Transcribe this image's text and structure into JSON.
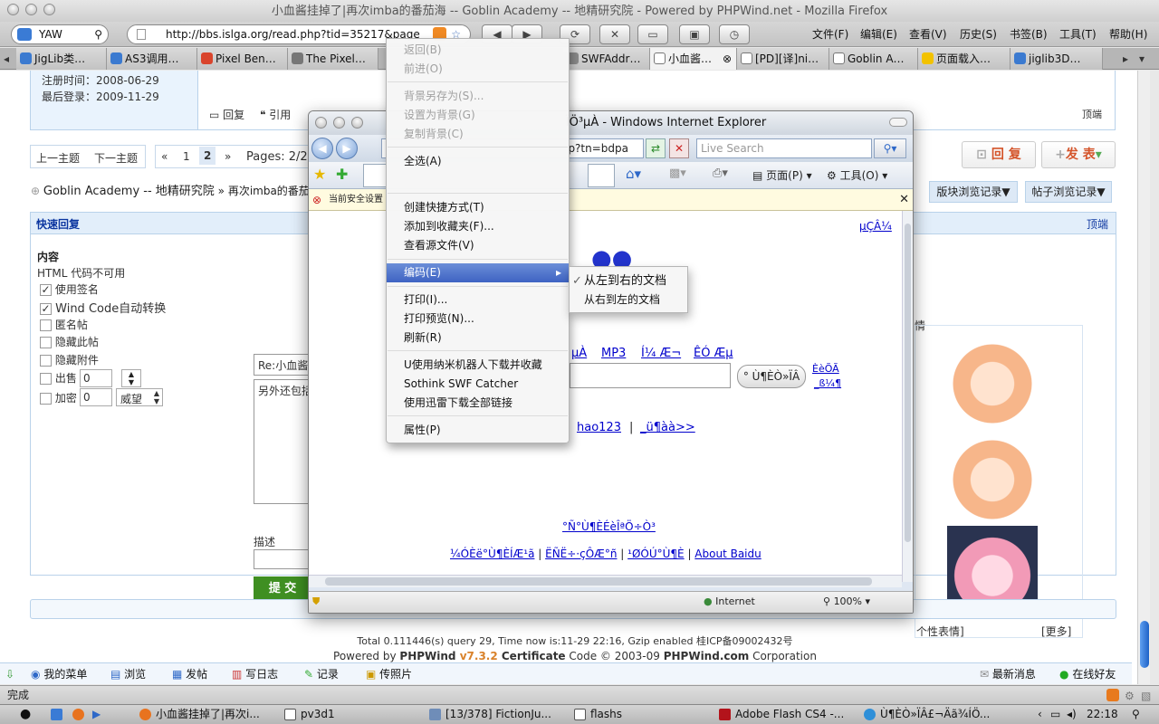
{
  "firefox": {
    "title": "小血酱挂掉了|再次imba的番茄海 -- Goblin Academy -- 地精研究院 - Powered by PHPWind.net - Mozilla Firefox",
    "search_value": "YAW",
    "url": "http://bbs.islga.org/read.php?tid=35217&page",
    "menus": [
      "文件(F)",
      "编辑(E)",
      "查看(V)",
      "历史(S)",
      "书签(B)",
      "工具(T)",
      "帮助(H)"
    ],
    "tabs": [
      "JigLib类…",
      "AS3调用…",
      "Pixel Ben…",
      "The Pixel…",
      "SWFAddr…",
      "小血酱…",
      "[PD][译]ni…",
      "Goblin A…",
      "页面载入…",
      "jiglib3D…"
    ],
    "status": "完成"
  },
  "forum": {
    "register_label": "注册时间：2008-06-29",
    "lastlogin_label": "最后登录：2009-11-29",
    "reply": "回复",
    "quote": "引用",
    "top": "顶端",
    "prev_topic": "上一主题",
    "next_topic": "下一主题",
    "pager": {
      "first": "«",
      "p1": "1",
      "p2": "2",
      "last": "»",
      "pages": "Pages: 2/2"
    },
    "btn_reply": "回 复",
    "btn_post": "发 表",
    "breadcrumb_home": "Goblin Academy -- 地精研究院",
    "breadcrumb_sep": "»",
    "breadcrumb_topic": "再次imba的番茄海",
    "board_history": "版块浏览记录▼",
    "post_history": "帖子浏览记录▼",
    "quick_reply": "快速回复",
    "top2": "顶端",
    "content_label": "内容",
    "html_note": "HTML 代码不可用",
    "opt_signature": "使用签名",
    "opt_windcode": "Wind Code自动转换",
    "opt_anonymous": "匿名帖",
    "opt_hide": "隐藏此帖",
    "opt_hide_attach": "隐藏附件",
    "opt_sell": "出售",
    "sell_value": "0",
    "opt_encrypt": "加密",
    "encrypt_value": "0",
    "prestige": "威望",
    "subject_value": "Re:小血酱",
    "body_value": "另外还包括",
    "desc_label": "描述",
    "submit": "提 交",
    "emoticon_head": "情",
    "emoticon_label": "个性表情]",
    "more": "[更多]",
    "footer1": "Total 0.111446(s) query 29, Time now is:11-29 22:16, Gzip enabled 桂ICP备09002432号",
    "footer2_pre": "Powered by ",
    "footer2_brand": "PHPWind",
    "footer2_ver": " v7.3.2 ",
    "footer2_cert": "Certificate",
    "footer2_mid": " Code © 2003-09 ",
    "footer2_site": "PHPWind.com",
    "footer2_end": " Corporation",
    "bar_items": [
      "我的菜单",
      "浏览",
      "发帖",
      "写日志",
      "记录",
      "传照片"
    ],
    "msg": "最新消息",
    "online": "在线好友"
  },
  "ie": {
    "title": "ÏÖ³µÀ - Windows Internet Explorer",
    "url_tail": "p?tn=bdpa",
    "search_placeholder": "Live Search",
    "page_menu": "页面(P)",
    "tools_menu": "工具(O)",
    "info_bar": "当前安全设置",
    "link_top": "µÇÂ¼",
    "nav_links": [
      "µÀ",
      "MP3",
      "Í¼ Æ¬",
      "ÊÓ Æµ"
    ],
    "search_btn": "° Ù¶ÈÒ»ÏÂ",
    "side_link1": "ÈèÕÃ",
    "side_link2": "_ß¼¶",
    "hao123": "hao123",
    "more_link": "_ü¶àà>>",
    "center_link": "°Ñ°Ù¶ÈÉèÎªÖ÷Ò³",
    "foot_links": [
      "¼ÓÈë°Ù¶ÈÍÆ¹ã",
      "ËÑË÷·çÔÆ°ñ",
      "¹ØÓÚ°Ù¶È",
      "About Baidu"
    ],
    "zone": "Internet",
    "zoom": "100%"
  },
  "context_menu": {
    "items": [
      {
        "label": "返回(B)",
        "enabled": false
      },
      {
        "label": "前进(O)",
        "enabled": false
      },
      {
        "label": "背景另存为(S)...",
        "enabled": false
      },
      {
        "label": "设置为背景(G)",
        "enabled": false
      },
      {
        "label": "复制背景(C)",
        "enabled": false
      },
      {
        "label": "全选(A)",
        "enabled": true
      },
      {
        "label": "创建快捷方式(T)",
        "enabled": true
      },
      {
        "label": "添加到收藏夹(F)...",
        "enabled": true
      },
      {
        "label": "查看源文件(V)",
        "enabled": true
      },
      {
        "label": "编码(E)",
        "enabled": true
      },
      {
        "label": "打印(I)...",
        "enabled": true
      },
      {
        "label": "打印预览(N)...",
        "enabled": true
      },
      {
        "label": "刷新(R)",
        "enabled": true
      },
      {
        "label": "U使用纳米机器人下载并收藏",
        "enabled": true
      },
      {
        "label": "Sothink SWF Catcher",
        "enabled": true
      },
      {
        "label": "使用迅雷下载全部链接",
        "enabled": true
      },
      {
        "label": "属性(P)",
        "enabled": true
      }
    ],
    "submenu": [
      "从左到右的文档",
      "从右到左的文档"
    ],
    "submenu_check": "✓"
  },
  "dock": {
    "items": [
      "小血酱挂掉了|再次i...",
      "pv3d1",
      "[13/378] FictionJu...",
      "flashs",
      "Adobe Flash CS4 -...",
      "Ù¶ÈÒ»ÏÂ£¬Äã¾ÍÖ..."
    ],
    "time": "22:18"
  },
  "colors": {
    "accent": "#2e68c8",
    "forum_border": "#b9d2ea",
    "submit_green": "#3f8f22",
    "menu_highlight": "#3e63c3"
  }
}
